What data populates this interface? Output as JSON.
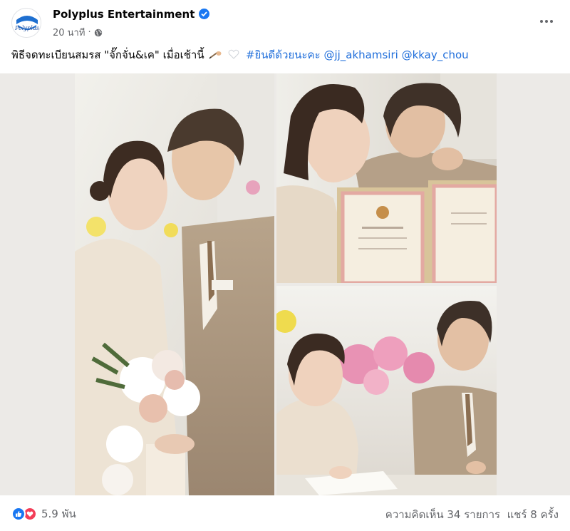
{
  "post": {
    "page_name": "Polyplus Entertainment",
    "logo_text": "Polyplus",
    "time": "20 นาที",
    "separator": "·",
    "caption_text": "พิธีจดทะเบียนสมรส \"จั๊กจั่น&เค\" เมื่อเช้านี้",
    "hashtag": "#ยินดีด้วยนะคะ",
    "mention1": "@jj_akhamsiri",
    "mention2": "@kkay_chou"
  },
  "footer": {
    "reaction_count": "5.9 พัน",
    "comments": "ความคิดเห็น 34 รายการ",
    "shares": "แชร์ 8 ครั้ง"
  },
  "icons": {
    "verified": "verified-badge-icon",
    "globe": "globe-icon",
    "more": "more-options-icon",
    "like": "like-reaction-icon",
    "love": "love-reaction-icon"
  },
  "colors": {
    "brand_blue": "#1877f2",
    "link_blue": "#216fdb",
    "love_red": "#f33e58",
    "meta_gray": "#65676b"
  }
}
